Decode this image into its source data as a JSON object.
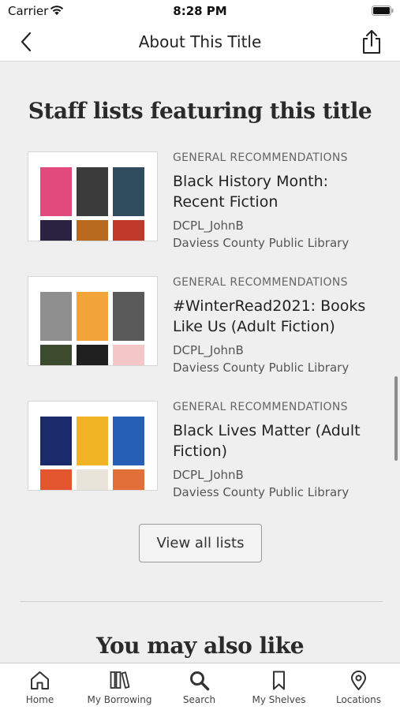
{
  "status_bar": {
    "carrier": "Carrier",
    "time": "8:28 PM"
  },
  "nav": {
    "title": "About This Title",
    "back_icon": "chevron-left-icon",
    "share_icon": "share-icon"
  },
  "staff_lists": {
    "heading": "Staff lists featuring this title",
    "items": [
      {
        "category": "GENERAL RECOMMENDATIONS",
        "title": "Black History Month: Recent Fiction",
        "owner": "DCPL_JohnB",
        "library": "Daviess County Public Library",
        "cover_colors": [
          "#e2497c",
          "#3b3b3b",
          "#2f4d5e",
          "#2a2240",
          "#b86a1e",
          "#c0392b"
        ]
      },
      {
        "category": "GENERAL RECOMMENDATIONS",
        "title": "#WinterRead2021: Books Like Us (Adult Fiction)",
        "owner": "DCPL_JohnB",
        "library": "Daviess County Public Library",
        "cover_colors": [
          "#8f8f8f",
          "#f2a33a",
          "#5a5a5a",
          "#3c4b2e",
          "#1f1f1f",
          "#f4c6c8"
        ]
      },
      {
        "category": "GENERAL RECOMMENDATIONS",
        "title": "Black Lives Matter (Adult Fiction)",
        "owner": "DCPL_JohnB",
        "library": "Daviess County Public Library",
        "cover_colors": [
          "#1b2a6b",
          "#f0b323",
          "#2560b5",
          "#e4572e",
          "#e9e4da",
          "#e26f39"
        ]
      }
    ]
  },
  "view_all_label": "View all lists",
  "also_like_heading": "You may also like",
  "tabs": [
    {
      "label": "Home",
      "icon": "home-icon"
    },
    {
      "label": "My Borrowing",
      "icon": "books-icon"
    },
    {
      "label": "Search",
      "icon": "search-icon"
    },
    {
      "label": "My Shelves",
      "icon": "bookmark-icon"
    },
    {
      "label": "Locations",
      "icon": "location-pin-icon"
    }
  ]
}
